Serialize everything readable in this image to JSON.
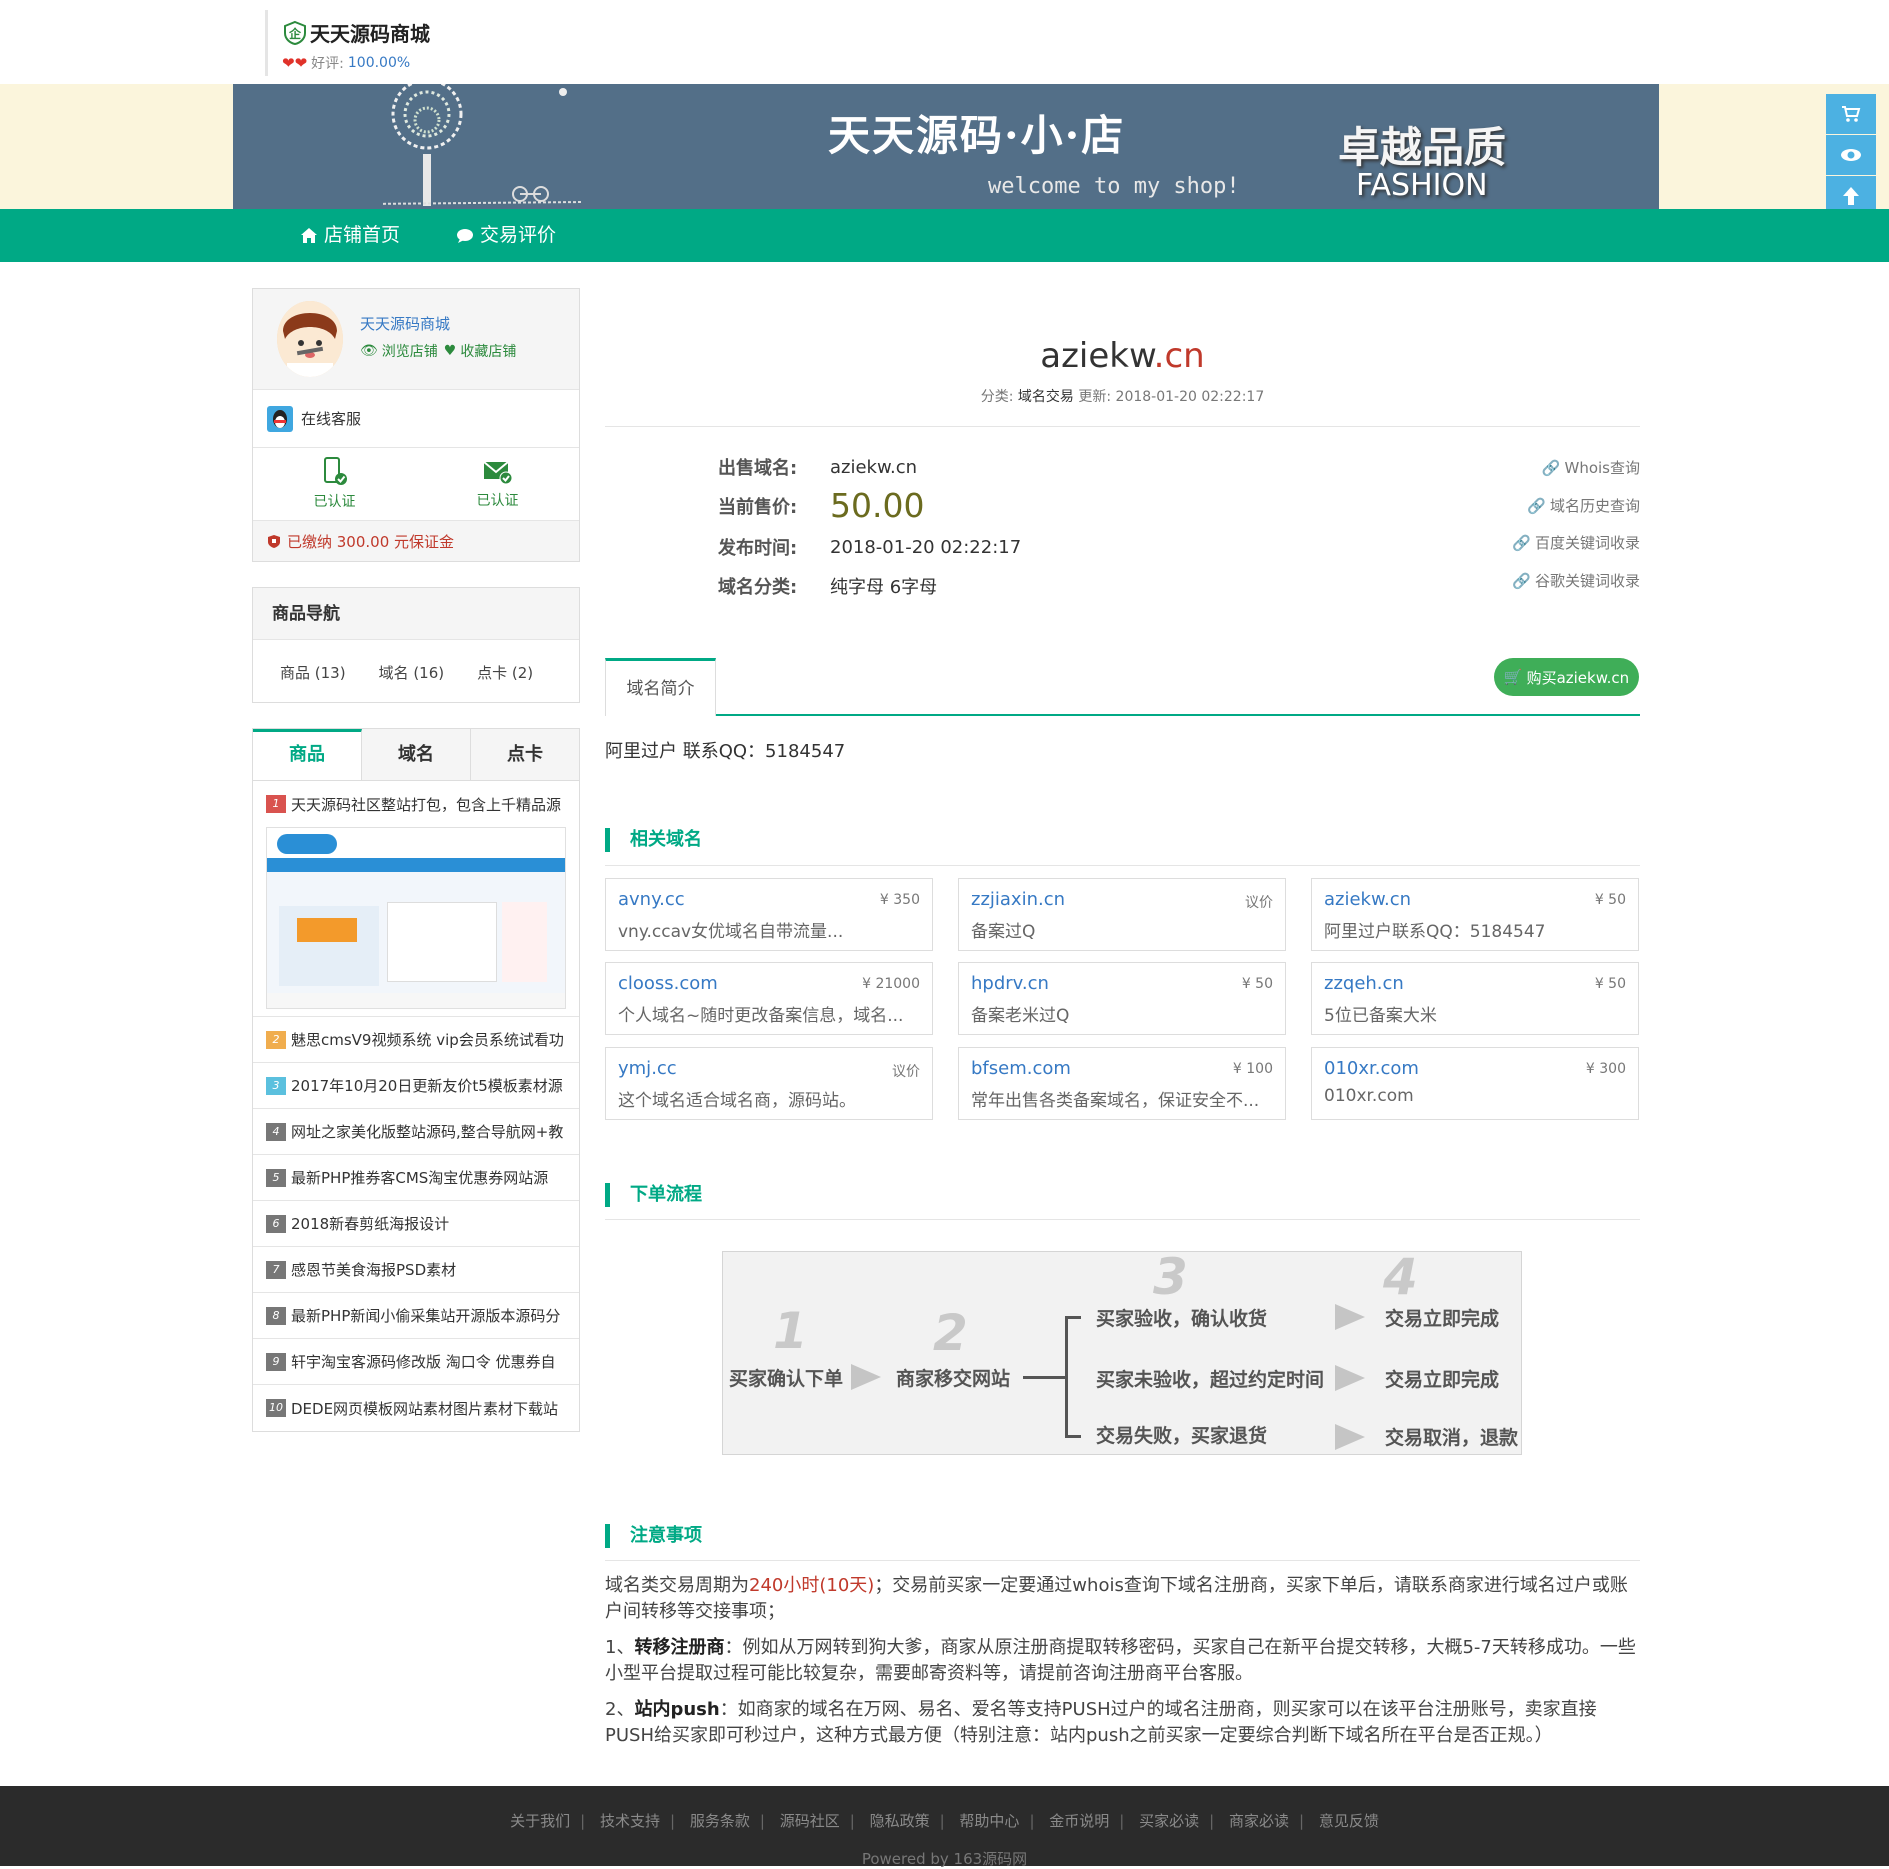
{
  "shop": {
    "name": "天天源码商城",
    "rating_label": "好评:",
    "rating_value": "100.00%"
  },
  "banner": {
    "title": "天天源码·小·店",
    "welcome": "welcome to my  shop!",
    "slogan": "卓越品质",
    "slogan_en": "FASHION"
  },
  "nav": {
    "home": "店铺首页",
    "reviews": "交易评价"
  },
  "side_tools": [
    "cart-icon",
    "eye-icon",
    "arrow-up-icon"
  ],
  "shop_card": {
    "name": "天天源码商城",
    "browse": "浏览店铺",
    "favorite": "收藏店铺",
    "kefu": "在线客服",
    "phone_verified": "已认证",
    "email_verified": "已认证",
    "deposit": "已缴纳 300.00 元保证金"
  },
  "cat_nav": {
    "title": "商品导航",
    "items": [
      "商品 (13)",
      "域名 (16)",
      "点卡 (2)"
    ]
  },
  "rank_tabs": [
    "商品",
    "域名",
    "点卡"
  ],
  "rank_list": [
    {
      "num": "1",
      "color": "#d9534f",
      "title": "天天源码社区整站打包，包含上千精品源"
    },
    {
      "num": "2",
      "color": "#f0ad4e",
      "title": "魅思cmsV9视频系统 vip会员系统试看功"
    },
    {
      "num": "3",
      "color": "#5bc0de",
      "title": "2017年10月20日更新友价t5模板素材源"
    },
    {
      "num": "4",
      "color": "#777777",
      "title": "网址之家美化版整站源码,整合导航网+教"
    },
    {
      "num": "5",
      "color": "#777777",
      "title": "最新PHP推券客CMS淘宝优惠券网站源"
    },
    {
      "num": "6",
      "color": "#777777",
      "title": "2018新春剪纸海报设计"
    },
    {
      "num": "7",
      "color": "#777777",
      "title": "感恩节美食海报PSD素材"
    },
    {
      "num": "8",
      "color": "#777777",
      "title": "最新PHP新闻小偷采集站开源版本源码分"
    },
    {
      "num": "9",
      "color": "#777777",
      "title": "轩宇淘宝客源码修改版 淘口令 优惠券自"
    },
    {
      "num": "10",
      "color": "#777777",
      "title": "DEDE网页模板网站素材图片素材下载站"
    }
  ],
  "product": {
    "domain_name": "aziekw",
    "domain_tld": ".cn",
    "meta_category_label": "分类:",
    "meta_category": "域名交易",
    "meta_updated_label": "更新:",
    "meta_updated": "2018-01-20 02:22:17",
    "info": [
      {
        "label": "出售域名:",
        "value": "aziekw.cn"
      },
      {
        "label": "当前售价:",
        "value": "50.00"
      },
      {
        "label": "发布时间:",
        "value": "2018-01-20 02:22:17"
      },
      {
        "label": "域名分类:",
        "value": "纯字母 6字母"
      }
    ],
    "links": [
      "Whois查询",
      "域名历史查询",
      "百度关键词收录",
      "谷歌关键词收录"
    ],
    "intro_tab": "域名简介",
    "buy_button": "购买aziekw.cn",
    "intro_text": "阿里过户 联系QQ：5184547"
  },
  "related": {
    "title": "相关域名",
    "items": [
      {
        "name": "avny.cc",
        "price": "¥ 350",
        "desc": "vny.ccav女优域名自带流量..."
      },
      {
        "name": "zzjiaxin.cn",
        "price": "议价",
        "desc": "备案过Q"
      },
      {
        "name": "aziekw.cn",
        "price": "¥ 50",
        "desc": "阿里过户联系QQ：5184547"
      },
      {
        "name": "clooss.com",
        "price": "¥ 21000",
        "desc": "个人域名~随时更改备案信息，域名..."
      },
      {
        "name": "hpdrv.cn",
        "price": "¥ 50",
        "desc": "备案老米过Q"
      },
      {
        "name": "zzqeh.cn",
        "price": "¥ 50",
        "desc": "5位已备案大米"
      },
      {
        "name": "ymj.cc",
        "price": "议价",
        "desc": "这个域名适合域名商，源码站。"
      },
      {
        "name": "bfsem.com",
        "price": "¥ 100",
        "desc": "常年出售各类备案域名，保证安全不..."
      },
      {
        "name": "010xr.com",
        "price": "¥ 300",
        "desc": "010xr.com"
      }
    ]
  },
  "process": {
    "title": "下单流程",
    "steps": [
      "1",
      "2",
      "3",
      "4"
    ],
    "buyer_order": "买家确认下单",
    "seller_transfer": "商家移交网站",
    "branch1": "买家验收，确认收货",
    "branch2": "买家未验收，超过约定时间",
    "branch3": "交易失败，买家退货",
    "result1": "交易立即完成",
    "result2": "交易立即完成",
    "result3": "交易取消，退款"
  },
  "notes": {
    "title": "注意事项",
    "p1_pre": "域名类交易周期为",
    "p1_red": "240小时(10天)",
    "p1_post": "；交易前买家一定要通过whois查询下域名注册商，买家下单后，请联系商家进行域名过户或账户间转移等交接事项；",
    "p2_num": "1、",
    "p2_bold": "转移注册商",
    "p2_text": "：例如从万网转到狗大爹，商家从原注册商提取转移密码，买家自己在新平台提交转移，大概5-7天转移成功。一些小型平台提取过程可能比较复杂，需要邮寄资料等，请提前咨询注册商平台客服。",
    "p3_num": "2、",
    "p3_bold": "站内push",
    "p3_text": "：如商家的域名在万网、易名、爱名等支持PUSH过户的域名注册商，则买家可以在该平台注册账号，卖家直接PUSH给买家即可秒过户，这种方式最方便（特别注意：站内push之前买家一定要综合判断下域名所在平台是否正规。）"
  },
  "footer": {
    "links": [
      "关于我们",
      "技术支持",
      "服务条款",
      "源码社区",
      "隐私政策",
      "帮助中心",
      "金币说明",
      "买家必读",
      "商家必读",
      "意见反馈"
    ],
    "powered": "Powered by 163源码网"
  },
  "colors": {
    "accent": "#00a985",
    "link": "#3679c4",
    "price_red": "#c0392b",
    "buy_button": "#3fae58"
  }
}
